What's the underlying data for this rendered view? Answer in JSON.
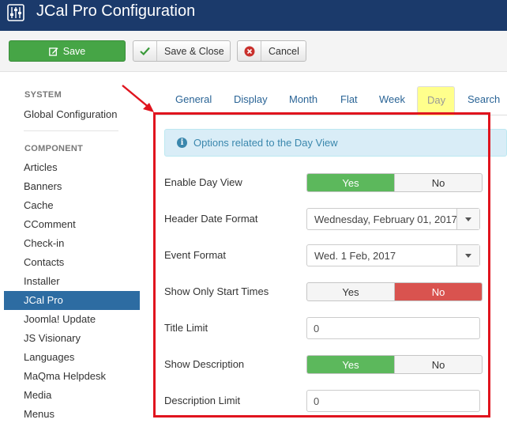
{
  "header": {
    "title": "JCal Pro Configuration",
    "logo_icon": "sliders-icon"
  },
  "toolbar": {
    "save_label": "Save",
    "save_close_label": "Save & Close",
    "cancel_label": "Cancel"
  },
  "sidebar": {
    "system_heading": "SYSTEM",
    "system_items": [
      "Global Configuration"
    ],
    "component_heading": "COMPONENT",
    "component_items": [
      "Articles",
      "Banners",
      "Cache",
      "CComment",
      "Check-in",
      "Contacts",
      "Installer",
      "JCal Pro",
      "Joomla! Update",
      "JS Visionary",
      "Languages",
      "MaQma Helpdesk",
      "Media",
      "Menus"
    ],
    "active": "JCal Pro"
  },
  "tabs": [
    "General",
    "Display",
    "Month",
    "Flat",
    "Week",
    "Day",
    "Search"
  ],
  "active_tab": "Day",
  "alert": {
    "text": "Options related to the Day View"
  },
  "form": {
    "enable_day_view": {
      "label": "Enable Day View",
      "yes": "Yes",
      "no": "No",
      "value": "Yes"
    },
    "header_date_format": {
      "label": "Header Date Format",
      "value": "Wednesday, February 01, 2017"
    },
    "event_format": {
      "label": "Event Format",
      "value": "Wed. 1 Feb, 2017"
    },
    "show_only_start_times": {
      "label": "Show Only Start Times",
      "yes": "Yes",
      "no": "No",
      "value": "No"
    },
    "title_limit": {
      "label": "Title Limit",
      "value": "0"
    },
    "show_description": {
      "label": "Show Description",
      "yes": "Yes",
      "no": "No",
      "value": "Yes"
    },
    "description_limit": {
      "label": "Description Limit",
      "value": "0"
    }
  },
  "colors": {
    "header_bg": "#1b3a6b",
    "save_green": "#46a546",
    "active_blue": "#2d6ca2",
    "highlight_red": "#e0141e",
    "toggle_yes": "#5cb85c",
    "toggle_no": "#d9534f"
  }
}
